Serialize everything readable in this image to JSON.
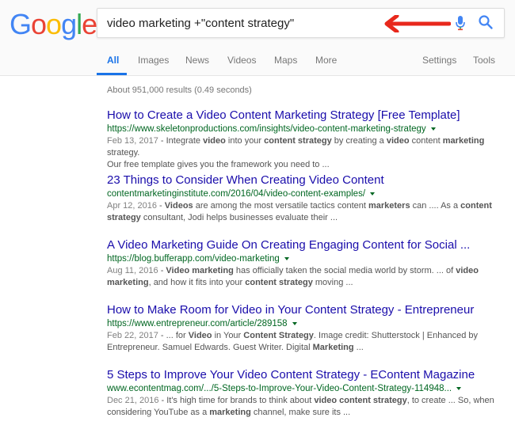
{
  "logo": {
    "letters": [
      {
        "char": "G",
        "color": "#4285F4"
      },
      {
        "char": "o",
        "color": "#EA4335"
      },
      {
        "char": "o",
        "color": "#FBBC05"
      },
      {
        "char": "g",
        "color": "#4285F4"
      },
      {
        "char": "l",
        "color": "#34A853"
      },
      {
        "char": "e",
        "color": "#EA4335"
      }
    ]
  },
  "search": {
    "query": "video marketing +\"content strategy\""
  },
  "annotation": {
    "arrow_color": "#E8281C"
  },
  "tabs": [
    {
      "label": "All",
      "active": true
    },
    {
      "label": "Images"
    },
    {
      "label": "News"
    },
    {
      "label": "Videos"
    },
    {
      "label": "Maps"
    },
    {
      "label": "More"
    },
    {
      "label": "Settings"
    },
    {
      "label": "Tools"
    }
  ],
  "stats": "About 951,000 results (0.49 seconds)",
  "results": [
    {
      "title": "How to Create a Video Content Marketing Strategy [Free Template]",
      "url": "https://www.skeletonproductions.com/insights/video-content-marketing-strategy",
      "snippet_line1": [
        {
          "t": "Feb 13, 2017",
          "b": false,
          "date": true
        },
        {
          "t": " - Integrate ",
          "b": false
        },
        {
          "t": "video",
          "b": true
        },
        {
          "t": " into your ",
          "b": false
        },
        {
          "t": "content strategy",
          "b": true
        },
        {
          "t": " by creating a ",
          "b": false
        },
        {
          "t": "video",
          "b": true
        },
        {
          "t": " content ",
          "b": false
        },
        {
          "t": "marketing",
          "b": true
        },
        {
          "t": " strategy.",
          "b": false
        }
      ],
      "snippet_line2": [
        {
          "t": "Our free template gives you the framework you need to ...",
          "b": false
        }
      ]
    },
    {
      "title": "23 Things to Consider When Creating Video Content",
      "url": "contentmarketinginstitute.com/2016/04/video-content-examples/",
      "snippet_line1": [
        {
          "t": "Apr 12, 2016",
          "b": false,
          "date": true
        },
        {
          "t": " - ",
          "b": false
        },
        {
          "t": "Videos",
          "b": true
        },
        {
          "t": " are among the most versatile tactics content ",
          "b": false
        },
        {
          "t": "marketers",
          "b": true
        },
        {
          "t": " can .... As a ",
          "b": false
        },
        {
          "t": "content",
          "b": true
        }
      ],
      "snippet_line2": [
        {
          "t": "strategy",
          "b": true
        },
        {
          "t": " consultant, Jodi helps businesses evaluate their ...",
          "b": false
        }
      ]
    },
    {
      "title": "A Video Marketing Guide On Creating Engaging Content for Social ...",
      "url": "https://blog.bufferapp.com/video-marketing",
      "snippet_line1": [
        {
          "t": "Aug 11, 2016",
          "b": false,
          "date": true
        },
        {
          "t": " - ",
          "b": false
        },
        {
          "t": "Video marketing",
          "b": true
        },
        {
          "t": " has officially taken the social media world by storm. ... of ",
          "b": false
        },
        {
          "t": "video",
          "b": true
        }
      ],
      "snippet_line2": [
        {
          "t": "marketing",
          "b": true
        },
        {
          "t": ", and how it fits into your ",
          "b": false
        },
        {
          "t": "content strategy",
          "b": true
        },
        {
          "t": " moving ...",
          "b": false
        }
      ]
    },
    {
      "title": "How to Make Room for Video in Your Content Strategy - Entrepreneur",
      "url": "https://www.entrepreneur.com/article/289158",
      "snippet_line1": [
        {
          "t": "Feb 22, 2017",
          "b": false,
          "date": true
        },
        {
          "t": " - ... for ",
          "b": false
        },
        {
          "t": "Video",
          "b": true
        },
        {
          "t": " in Your ",
          "b": false
        },
        {
          "t": "Content Strategy",
          "b": true
        },
        {
          "t": ". Image credit: Shutterstock | Enhanced by",
          "b": false
        }
      ],
      "snippet_line2": [
        {
          "t": "Entrepreneur. Samuel Edwards. Guest Writer. Digital ",
          "b": false
        },
        {
          "t": "Marketing",
          "b": true
        },
        {
          "t": " ...",
          "b": false
        }
      ]
    },
    {
      "title": "5 Steps to Improve Your Video Content Strategy - EContent Magazine",
      "url": "www.econtentmag.com/.../5-Steps-to-Improve-Your-Video-Content-Strategy-114948...",
      "snippet_line1": [
        {
          "t": "Dec 21, 2016",
          "b": false,
          "date": true
        },
        {
          "t": " - It's high time for brands to think about ",
          "b": false
        },
        {
          "t": "video content strategy",
          "b": true
        },
        {
          "t": ", to create ... So, when",
          "b": false
        }
      ],
      "snippet_line2": [
        {
          "t": "considering YouTube as a ",
          "b": false
        },
        {
          "t": "marketing",
          "b": true
        },
        {
          "t": " channel, make sure its ...",
          "b": false
        }
      ]
    }
  ]
}
